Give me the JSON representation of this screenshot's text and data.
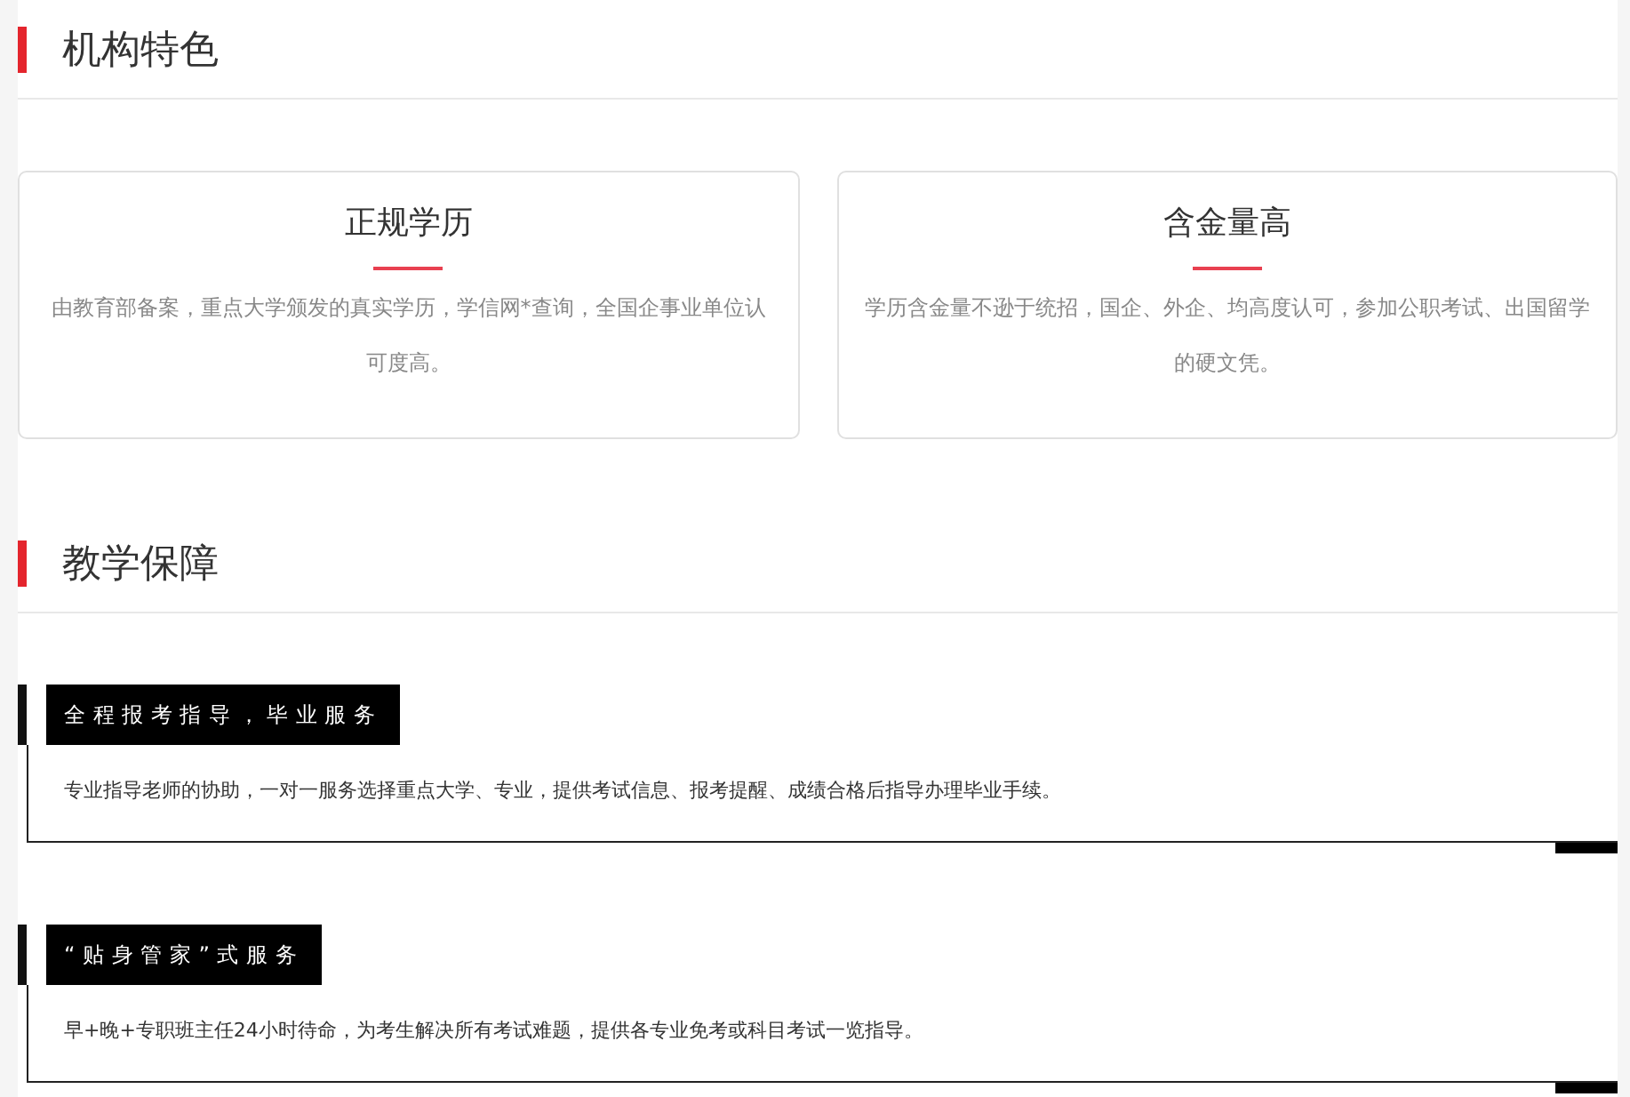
{
  "sections": [
    {
      "kind": "cards",
      "title": "机构特色",
      "cards": [
        {
          "title": "正规学历",
          "description": "由教育部备案，重点大学颁发的真实学历，学信网*查询，全国企事业单位认可度高。"
        },
        {
          "title": "含金量高",
          "description": "学历含金量不逊于统招，国企、外企、均高度认可，参加公职考试、出国留学的硬文凭。"
        }
      ]
    },
    {
      "kind": "services",
      "title": "教学保障",
      "items": [
        {
          "label": "全程报考指导，毕业服务",
          "description": "专业指导老师的协助，一对一服务选择重点大学、专业，提供考试信息、报考提醒、成绩合格后指导办理毕业手续。"
        },
        {
          "label": "“贴身管家”式服务",
          "description": "早+晚+专职班主任24小时待命，为考生解决所有考试难题，提供各专业免考或科目考试一览指导。"
        }
      ]
    }
  ]
}
